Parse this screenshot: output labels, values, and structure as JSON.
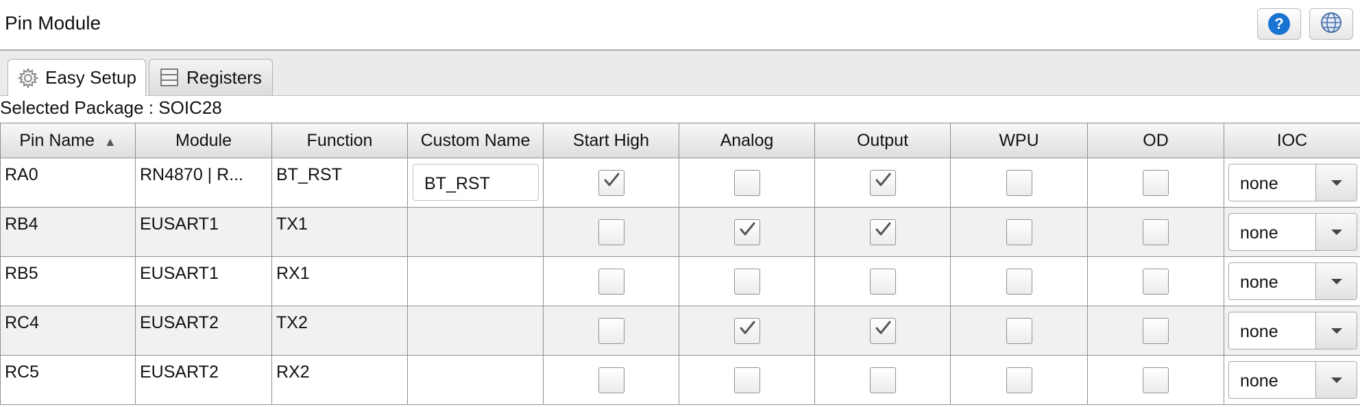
{
  "header": {
    "title": "Pin Module",
    "help_label": "?"
  },
  "tabs": [
    {
      "label": "Easy Setup",
      "icon": "gear-icon",
      "active": true
    },
    {
      "label": "Registers",
      "icon": "registers-icon",
      "active": false
    }
  ],
  "package_label": "Selected Package : SOIC28",
  "table": {
    "columns": [
      "Pin Name",
      "Module",
      "Function",
      "Custom Name",
      "Start High",
      "Analog",
      "Output",
      "WPU",
      "OD",
      "IOC"
    ],
    "sort_indicator": "▲",
    "rows": [
      {
        "pin": "RA0",
        "module": "RN4870 | R...",
        "function": "BT_RST",
        "custom_name": "BT_RST",
        "start_high": true,
        "analog": false,
        "output": true,
        "wpu": false,
        "od": false,
        "ioc": "none"
      },
      {
        "pin": "RB4",
        "module": "EUSART1",
        "function": "TX1",
        "custom_name": "",
        "start_high": false,
        "analog": true,
        "output": true,
        "wpu": false,
        "od": false,
        "ioc": "none"
      },
      {
        "pin": "RB5",
        "module": "EUSART1",
        "function": "RX1",
        "custom_name": "",
        "start_high": false,
        "analog": false,
        "output": false,
        "wpu": false,
        "od": false,
        "ioc": "none"
      },
      {
        "pin": "RC4",
        "module": "EUSART2",
        "function": "TX2",
        "custom_name": "",
        "start_high": false,
        "analog": true,
        "output": true,
        "wpu": false,
        "od": false,
        "ioc": "none"
      },
      {
        "pin": "RC5",
        "module": "EUSART2",
        "function": "RX2",
        "custom_name": "",
        "start_high": false,
        "analog": false,
        "output": false,
        "wpu": false,
        "od": false,
        "ioc": "none"
      }
    ]
  }
}
